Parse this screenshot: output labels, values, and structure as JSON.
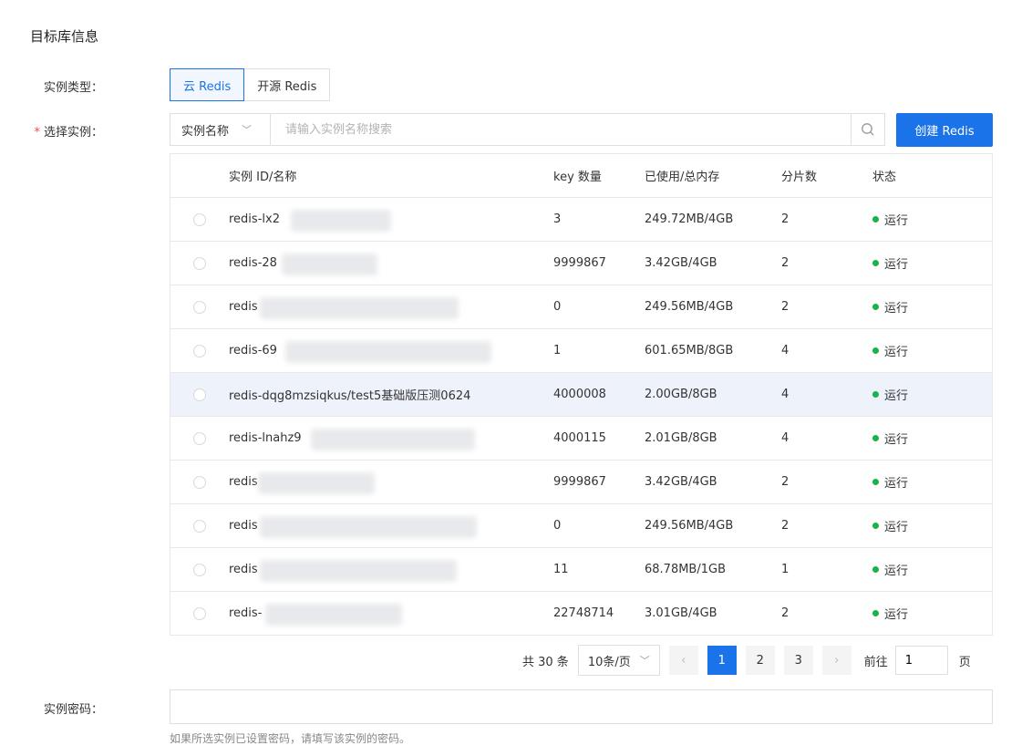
{
  "section_title": "目标库信息",
  "instance_type": {
    "label": "实例类型：",
    "options": [
      "云 Redis",
      "开源 Redis"
    ],
    "selected": "云 Redis"
  },
  "select_instance": {
    "required_mark": "*",
    "label": "选择实例：",
    "filter_field": "实例名称",
    "search_placeholder": "请输入实例名称搜索",
    "create_button": "创建 Redis"
  },
  "table": {
    "columns": [
      "实例 ID/名称",
      "key 数量",
      "已使用/总内存",
      "分片数",
      "状态"
    ],
    "rows": [
      {
        "id": "redis-lx2",
        "keys": "3",
        "memory": "249.72MB/4GB",
        "shards": "2",
        "status": "运行"
      },
      {
        "id": "redis-28",
        "keys": "9999867",
        "memory": "3.42GB/4GB",
        "shards": "2",
        "status": "运行"
      },
      {
        "id": "redis",
        "keys": "0",
        "memory": "249.56MB/4GB",
        "shards": "2",
        "status": "运行"
      },
      {
        "id": "redis-69",
        "keys": "1",
        "memory": "601.65MB/8GB",
        "shards": "4",
        "status": "运行"
      },
      {
        "id": "redis-dqg8mzsiqkus/test5基础版压测0624",
        "keys": "4000008",
        "memory": "2.00GB/8GB",
        "shards": "4",
        "status": "运行"
      },
      {
        "id": "redis-lnahz9",
        "keys": "4000115",
        "memory": "2.01GB/8GB",
        "shards": "4",
        "status": "运行"
      },
      {
        "id": "redis",
        "keys": "9999867",
        "memory": "3.42GB/4GB",
        "shards": "2",
        "status": "运行"
      },
      {
        "id": "redis",
        "keys": "0",
        "memory": "249.56MB/4GB",
        "shards": "2",
        "status": "运行"
      },
      {
        "id": "redis",
        "keys": "11",
        "memory": "68.78MB/1GB",
        "shards": "1",
        "status": "运行"
      },
      {
        "id": "redis-",
        "keys": "22748714",
        "memory": "3.01GB/4GB",
        "shards": "2",
        "status": "运行"
      }
    ]
  },
  "pagination": {
    "total": "共 30 条",
    "page_size": "10条/页",
    "pages": [
      "1",
      "2",
      "3"
    ],
    "current_page": "1",
    "prev": "‹",
    "next": "›",
    "goto_label": "前往",
    "goto_value": "1",
    "goto_unit": "页"
  },
  "password": {
    "label": "实例密码：",
    "value": "",
    "hint": "如果所选实例已设置密码，请填写该实例的密码。"
  },
  "colors": {
    "accent": "#1a73e8",
    "running": "#16b24b",
    "highlight_row": "#eef2fb"
  },
  "icons": [
    "search-icon",
    "chevron-down-icon",
    "status-dot-icon"
  ]
}
